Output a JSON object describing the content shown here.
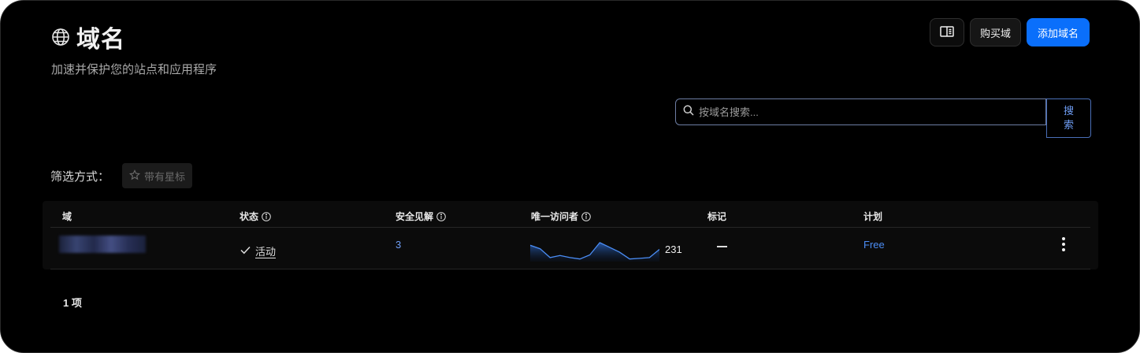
{
  "header": {
    "title": "域名",
    "subtitle": "加速并保护您的站点和应用程序",
    "globe_icon": "globe-icon"
  },
  "actions": {
    "docs_icon": "book-icon",
    "buy_label": "购买域",
    "add_label": "添加域名"
  },
  "search": {
    "placeholder": "按域名搜索...",
    "button_label": "搜索"
  },
  "filter": {
    "label": "筛选方式：",
    "starred_label": "带有星标"
  },
  "table": {
    "columns": {
      "domain": "域",
      "status": "状态",
      "insights": "安全见解",
      "visitors": "唯一访问者",
      "tags": "标记",
      "plan": "计划"
    },
    "rows": [
      {
        "domain": "",
        "status": "活动",
        "insights": "3",
        "visitors": "231",
        "visitors_trend": [
          0.72,
          0.55,
          0.12,
          0.22,
          0.12,
          0.05,
          0.25,
          0.85,
          0.62,
          0.38,
          0.05,
          0.08,
          0.12,
          0.52
        ],
        "tags": "—",
        "plan": "Free"
      }
    ]
  },
  "footer": {
    "count": "1 项"
  },
  "colors": {
    "accent": "#0a6ffb",
    "link": "#6f9ef5",
    "spark_line": "#4b8df5"
  }
}
